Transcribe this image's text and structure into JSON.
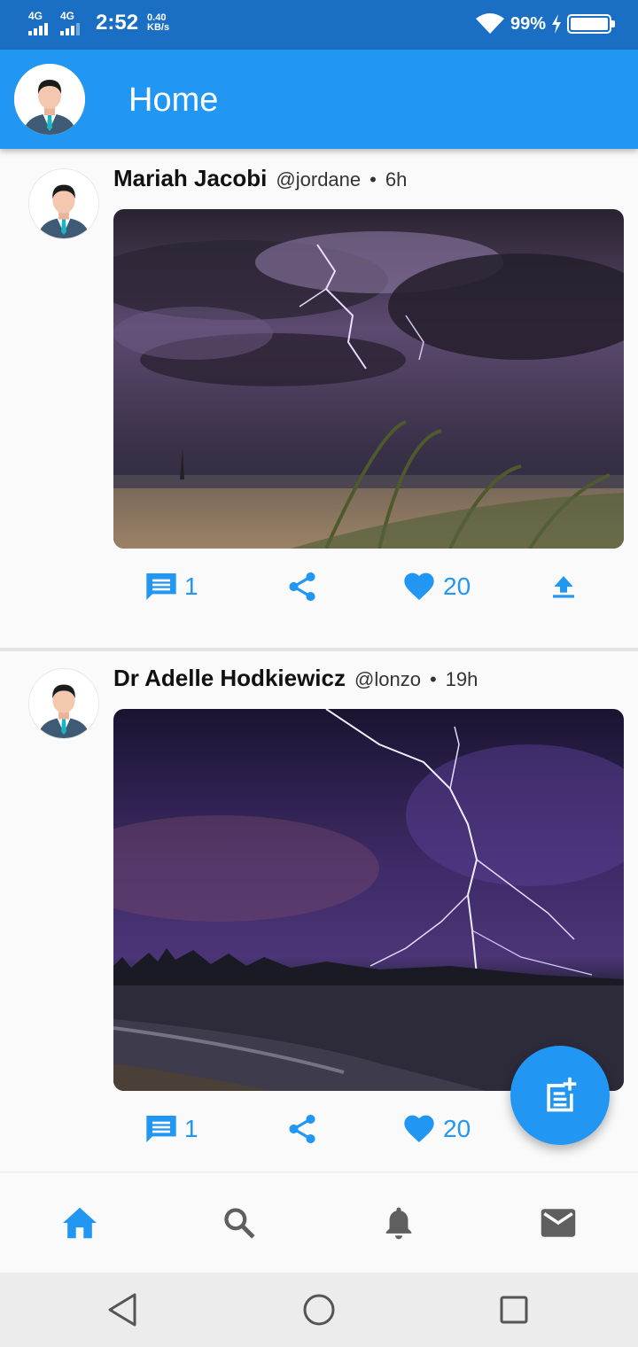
{
  "status_bar": {
    "network1": "4G",
    "network2": "4G",
    "time": "2:52",
    "speed_value": "0.40",
    "speed_unit": "KB/s",
    "battery": "99%",
    "battery_level": 0.99,
    "icons": [
      "signal-icon",
      "wifi-icon",
      "charging-icon",
      "battery-icon"
    ]
  },
  "app_bar": {
    "title": "Home",
    "avatar_icon": "profile-avatar-icon"
  },
  "posts": [
    {
      "author": "Mariah Jacobi",
      "handle": "@jordane",
      "separator": "•",
      "time": "6h",
      "image": "storm-over-beach-photo",
      "comments": "1",
      "likes": "20"
    },
    {
      "author": "Dr Adelle Hodkiewicz",
      "handle": "@lonzo",
      "separator": "•",
      "time": "19h",
      "image": "lightning-over-city-coast-photo",
      "comments": "1",
      "likes": "20"
    }
  ],
  "action_icons": [
    "comment-icon",
    "share-icon",
    "heart-icon",
    "upload-icon"
  ],
  "fab": {
    "icon": "new-post-icon"
  },
  "bottom_nav": {
    "items": [
      "home-icon",
      "search-icon",
      "bell-icon",
      "mail-icon"
    ],
    "active": "home-icon"
  },
  "system_nav": [
    "back-icon",
    "home-circle-icon",
    "recents-icon"
  ],
  "colors": {
    "primary": "#2196f3",
    "status_bar": "#1a6fc4",
    "inactive_icon": "#5f5f5f",
    "background": "#fafafa"
  }
}
